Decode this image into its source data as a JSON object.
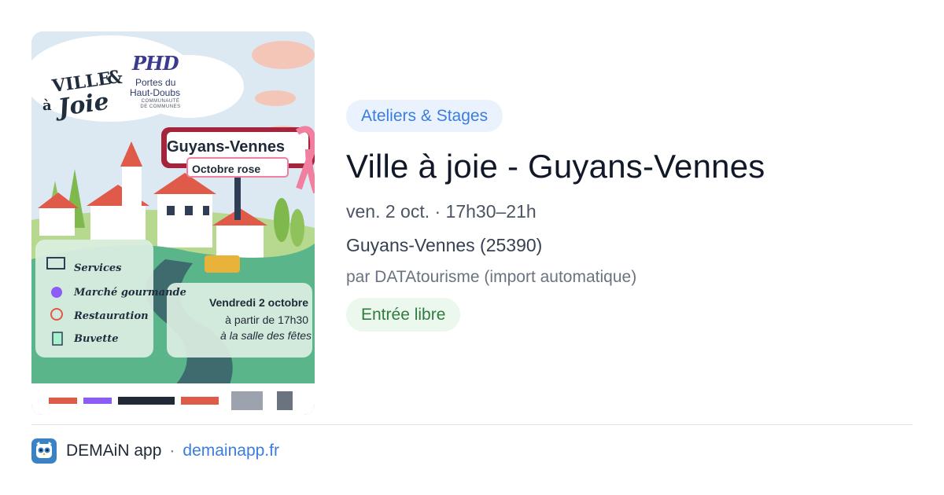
{
  "event": {
    "category": "Ateliers & Stages",
    "title": "Ville à joie - Guyans-Vennes",
    "datetime": "ven. 2 oct. · 17h30–21h",
    "location": "Guyans-Vennes (25390)",
    "organizer": "par DATAtourisme (import automatique)",
    "price": "Entrée libre"
  },
  "poster": {
    "heading_line1": "VILLE",
    "heading_line2": "Joie",
    "heading_prefix": "à",
    "ampersand": "&",
    "logo_text": "PHD",
    "org_line1": "Portes du",
    "org_line2": "Haut-Doubs",
    "org_sub": "COMMUNAUTÉ DE COMMUNES",
    "town": "Guyans-Vennes",
    "subtitle": "Octobre rose",
    "activities": [
      "Services",
      "Marché gourmande",
      "Restauration",
      "Buvette"
    ],
    "date": "Vendredi 2 octobre",
    "time": "à partir de 17h30",
    "place": "à la salle des fêtes",
    "colors": {
      "sky": "#dce9f2",
      "grass": "#5bb58a",
      "pink": "#f07fa0",
      "sign": "#a3243b"
    }
  },
  "footer": {
    "app_name": "DEMAiN app",
    "separator": "·",
    "link": "demainapp.fr",
    "icon": "owl-app-icon"
  },
  "colors": {
    "accent": "#3b7ddd",
    "category_bg": "#eaf3fd",
    "price_bg": "#ecf7ee",
    "price_text": "#2f7d3e"
  }
}
